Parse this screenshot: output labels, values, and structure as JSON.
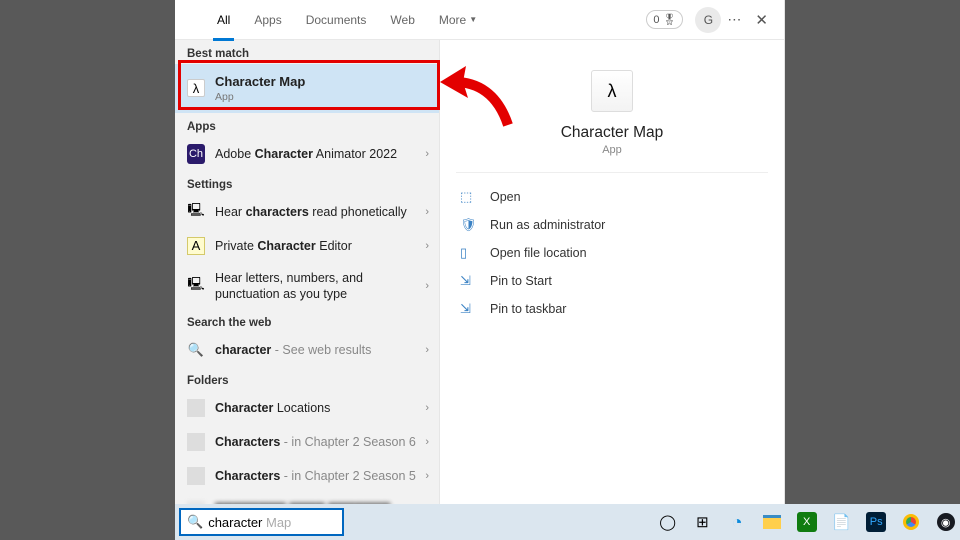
{
  "tabs": {
    "all": "All",
    "apps": "Apps",
    "documents": "Documents",
    "web": "Web",
    "more": "More"
  },
  "header": {
    "count": "0",
    "user": "G"
  },
  "sections": {
    "best": "Best match",
    "apps": "Apps",
    "settings": "Settings",
    "web": "Search the web",
    "folders": "Folders"
  },
  "best": {
    "title": "Character Map",
    "sub": "App"
  },
  "appsList": {
    "adobe": "Adobe Character Animator 2022"
  },
  "settingsList": {
    "hear": "Hear characters read phonetically",
    "pce": "Private Character Editor",
    "letters": "Hear letters, numbers, and punctuation as you type"
  },
  "webList": {
    "char": "character",
    "suffix": " - See web results"
  },
  "folders": {
    "loc": "Character Locations",
    "s6_a": "Characters",
    "s6_b": " - in Chapter 2 Season 6",
    "s5_a": "Characters",
    "s5_b": " - in Chapter 2 Season 5"
  },
  "preview": {
    "title": "Character Map",
    "type": "App",
    "glyph": "λ"
  },
  "actions": {
    "open": "Open",
    "admin": "Run as administrator",
    "loc": "Open file location",
    "pinstart": "Pin to Start",
    "pintask": "Pin to taskbar"
  },
  "search": {
    "typed": "character",
    "ghost": "Map"
  }
}
